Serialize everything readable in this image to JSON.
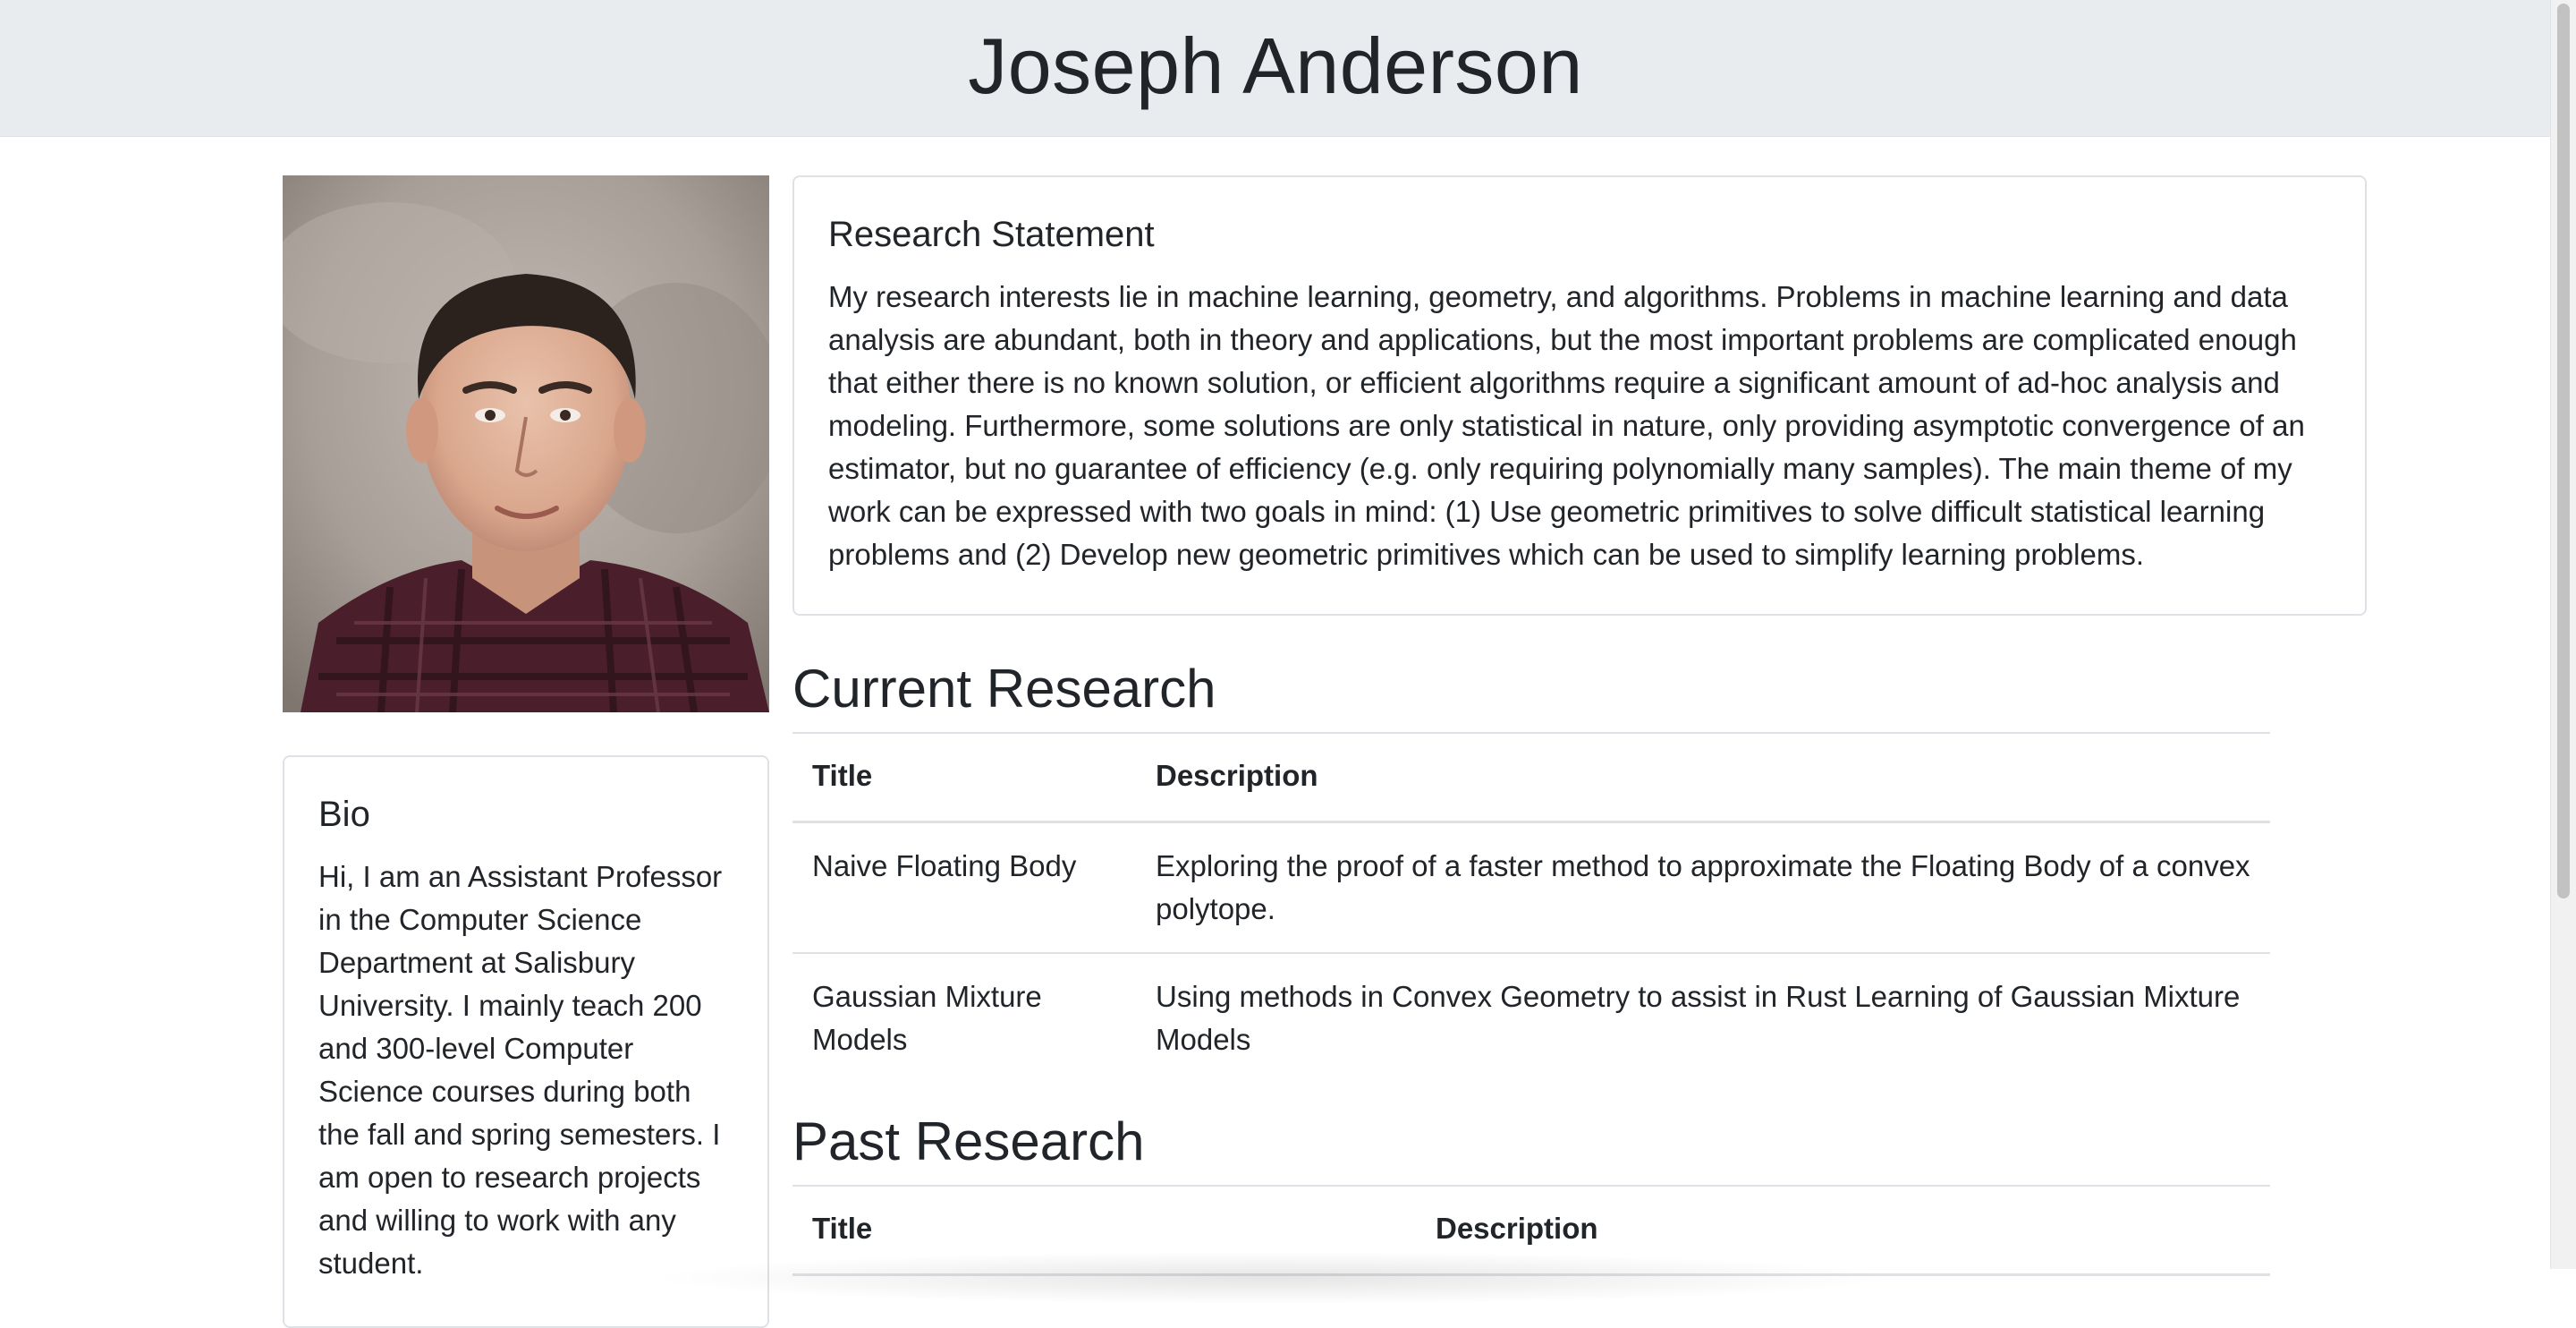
{
  "header": {
    "name": "Joseph Anderson"
  },
  "photo": {
    "alt": "Portrait of Joseph Anderson"
  },
  "research_statement": {
    "heading": "Research Statement",
    "text": "My research interests lie in machine learning, geometry, and algorithms. Problems in machine learning and data analysis are abundant, both in theory and applications, but the most important problems are complicated enough that either there is no known solution, or efficient algorithms require a significant amount of ad-hoc analysis and modeling. Furthermore, some solutions are only statistical in nature, only providing asymptotic convergence of an estimator, but no guarantee of efficiency (e.g. only requiring polynomially many samples). The main theme of my work can be expressed with two goals in mind: (1) Use geometric primitives to solve difficult statistical learning problems and (2) Develop new geometric primitives which can be used to simplify learning problems."
  },
  "bio": {
    "heading": "Bio",
    "text": "Hi, I am an Assistant Professor in the Computer Science Department at Salisbury University. I mainly teach 200 and 300-level Computer Science courses during both the fall and spring semesters. I am open to research projects and willing to work with any student."
  },
  "current_research": {
    "heading": "Current Research",
    "columns": [
      "Title",
      "Description"
    ],
    "rows": [
      [
        "Naive Floating Body",
        "Exploring the proof of a faster method to approximate the Floating Body of a convex polytope."
      ],
      [
        "Gaussian Mixture Models",
        "Using methods in Convex Geometry to assist in Rust Learning of Gaussian Mixture Models"
      ]
    ]
  },
  "past_research": {
    "heading": "Past Research",
    "columns": [
      "Title",
      "Description"
    ]
  }
}
